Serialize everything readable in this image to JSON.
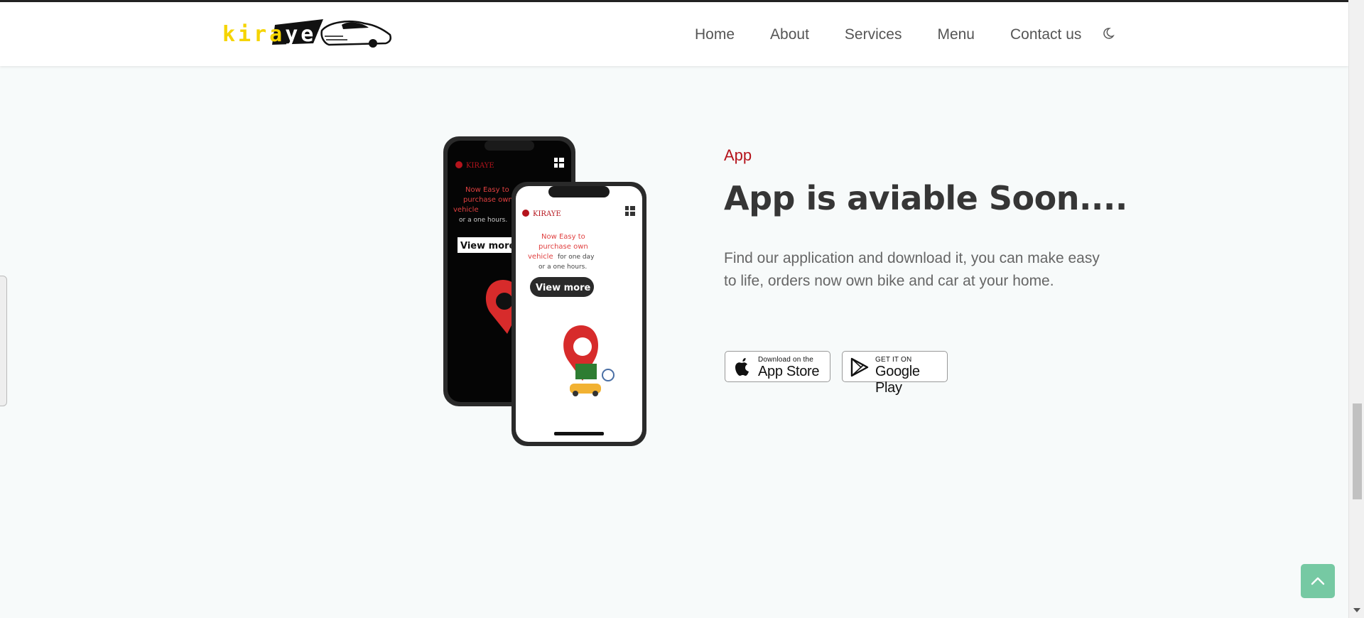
{
  "header": {
    "logo_text_a": "kira",
    "logo_text_b": "ye",
    "nav": [
      "Home",
      "About",
      "Services",
      "Menu",
      "Contact us"
    ],
    "theme_toggle_icon": "moon-icon"
  },
  "app_section": {
    "label": "App",
    "title": "App is aviable Soon....",
    "description": "Find our application and download it, you can make easy to life, orders now own bike and car at your home.",
    "app_store": {
      "small": "Download on the",
      "big": "App Store",
      "icon": "apple-icon"
    },
    "google_play": {
      "small": "GET IT ON",
      "big": "Google Play",
      "icon": "play-icon"
    },
    "phone_screen": {
      "brand": "KIRAYE",
      "headline_1": "Now Easy to",
      "headline_2": "purchase own",
      "headline_3": "vehicle",
      "headline_rest": "for one day",
      "headline_4": "or a one hours.",
      "button": "View more"
    }
  },
  "colors": {
    "accent_red": "#b5141c",
    "logo_yellow": "#f5d400",
    "to_top_green": "#76c9a3"
  },
  "to_top_icon": "chevron-up-icon"
}
